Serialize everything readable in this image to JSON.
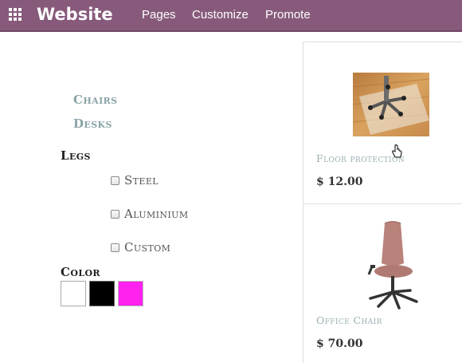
{
  "topbar": {
    "app_icon": "apps-grid-icon",
    "brand": "Website",
    "menu": [
      "Pages",
      "Customize",
      "Promote"
    ],
    "color": "#875a7b"
  },
  "filters": {
    "categories": [
      "Chairs",
      "Desks"
    ],
    "legs": {
      "title": "Legs",
      "options": [
        "Steel",
        "Aluminium",
        "Custom"
      ]
    },
    "color": {
      "title": "Color",
      "swatches": [
        "#ffffff",
        "#000000",
        "#ff22ee"
      ]
    }
  },
  "products": [
    {
      "name": "Floor protection",
      "price": "$ 12.00"
    },
    {
      "name": "Office Chair",
      "price": "$ 70.00"
    }
  ]
}
